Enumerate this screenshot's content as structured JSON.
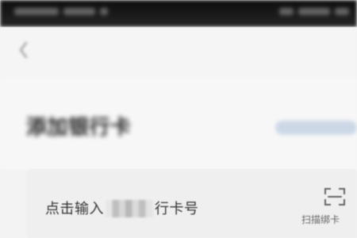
{
  "header": {
    "back_icon": "chevron-left-icon",
    "title": "添加银行卡"
  },
  "form": {
    "placeholder_prefix": "点击输入",
    "placeholder_suffix": "行卡号",
    "scan_label": "扫描绑卡",
    "scan_icon": "scan-frame-icon"
  }
}
